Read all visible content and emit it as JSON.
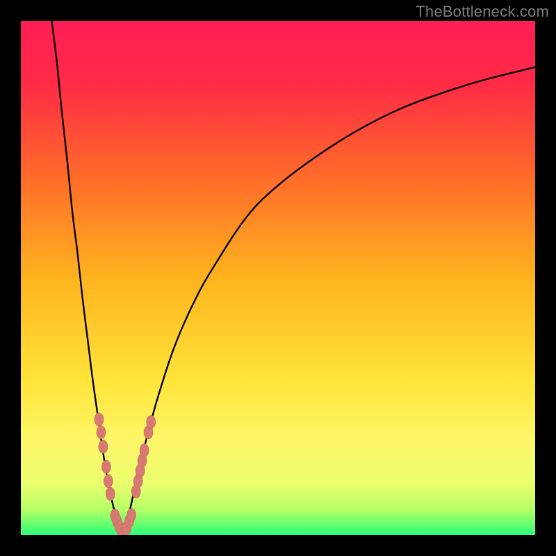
{
  "watermark": "TheBottleneck.com",
  "colors": {
    "frame": "#000000",
    "gradient_stops": [
      {
        "offset": 0.0,
        "color": "#ff1e55"
      },
      {
        "offset": 0.12,
        "color": "#ff2a46"
      },
      {
        "offset": 0.3,
        "color": "#ff6a2a"
      },
      {
        "offset": 0.5,
        "color": "#ffb31e"
      },
      {
        "offset": 0.7,
        "color": "#ffe43a"
      },
      {
        "offset": 0.82,
        "color": "#fff76a"
      },
      {
        "offset": 0.9,
        "color": "#eaff6e"
      },
      {
        "offset": 0.95,
        "color": "#b6ff66"
      },
      {
        "offset": 1.0,
        "color": "#2bff77"
      }
    ],
    "curve": "#000000",
    "marker_fill": "#d87a73",
    "marker_stroke": "#c9635c"
  },
  "chart_data": {
    "type": "line",
    "title": "",
    "xlabel": "",
    "ylabel": "",
    "xlim": [
      0,
      100
    ],
    "ylim": [
      0,
      100
    ],
    "x_minimum": 20,
    "series": [
      {
        "name": "left-branch",
        "x": [
          6,
          7,
          8,
          9,
          10,
          11,
          12,
          13,
          14,
          15,
          16,
          17,
          18,
          19,
          20
        ],
        "y": [
          100,
          92,
          82,
          73,
          63,
          55,
          46,
          38,
          30,
          23,
          16,
          10,
          5.5,
          2,
          0
        ]
      },
      {
        "name": "right-branch",
        "x": [
          20,
          21,
          22,
          23,
          24,
          25,
          27,
          30,
          34,
          38,
          44,
          50,
          58,
          66,
          74,
          82,
          90,
          100
        ],
        "y": [
          0,
          4,
          8.5,
          13,
          17,
          21,
          28,
          37,
          46,
          53,
          62,
          68,
          74,
          79,
          83,
          86,
          88.5,
          91
        ]
      }
    ],
    "markers": {
      "name": "near-minimum-points",
      "points": [
        {
          "x": 15.2,
          "y": 22.5
        },
        {
          "x": 15.6,
          "y": 20.0
        },
        {
          "x": 16.0,
          "y": 17.2
        },
        {
          "x": 16.6,
          "y": 13.3
        },
        {
          "x": 17.0,
          "y": 10.5
        },
        {
          "x": 17.4,
          "y": 8.0
        },
        {
          "x": 18.3,
          "y": 3.8
        },
        {
          "x": 18.7,
          "y": 2.7
        },
        {
          "x": 19.2,
          "y": 1.5
        },
        {
          "x": 19.6,
          "y": 0.8
        },
        {
          "x": 20.0,
          "y": 0.3
        },
        {
          "x": 20.6,
          "y": 1.4
        },
        {
          "x": 21.1,
          "y": 2.8
        },
        {
          "x": 21.5,
          "y": 3.9
        },
        {
          "x": 22.4,
          "y": 8.5
        },
        {
          "x": 22.8,
          "y": 10.5
        },
        {
          "x": 23.2,
          "y": 12.5
        },
        {
          "x": 23.6,
          "y": 14.5
        },
        {
          "x": 24.0,
          "y": 16.5
        },
        {
          "x": 24.8,
          "y": 20.0
        },
        {
          "x": 25.3,
          "y": 22.0
        }
      ]
    }
  }
}
